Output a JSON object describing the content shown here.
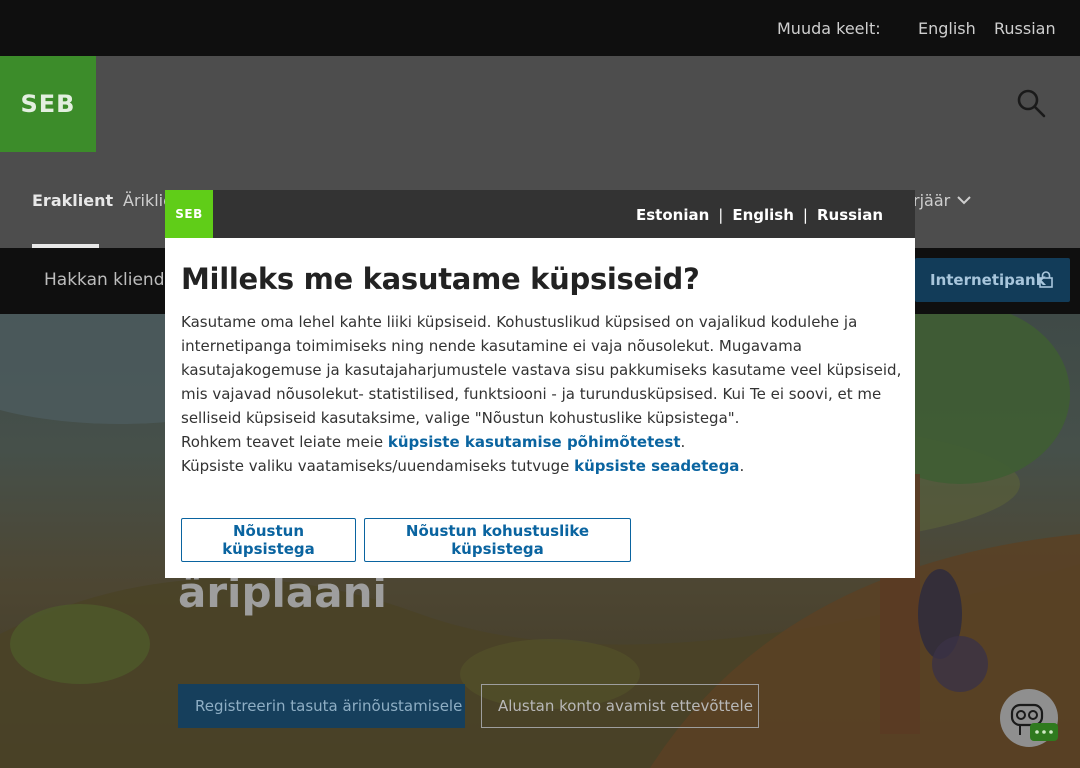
{
  "topbar": {
    "change_language_label": "Muuda keelt:",
    "lang_english": "English",
    "lang_russian": "Russian"
  },
  "header": {
    "logo_text": "SEB",
    "nav_items": {
      "private": "Eraklient",
      "business_partial": "Äriklient",
      "more_partial": "rjäär"
    }
  },
  "subbar": {
    "label_partial": "Hakkan kliendiks",
    "netbank_button": "Internetipank"
  },
  "hero": {
    "title_partial": "äriplaani",
    "register_button": "Registreerin tasuta ärinõustamisele",
    "open_account_button": "Alustan konto avamist ettevõttele"
  },
  "cookie_modal": {
    "logo_text": "SEB",
    "languages": {
      "estonian": "Estonian",
      "english": "English",
      "russian": "Russian",
      "separator": "|"
    },
    "title": "Milleks me kasutame küpsiseid?",
    "paragraph": "Kasutame oma lehel kahte liiki küpsiseid. Kohustuslikud küpsised on vajalikud kodulehe ja internetipanga toimimiseks ning nende kasutamine ei vaja nõusolekut. Mugavama kasutajakogemuse ja kasutajaharjumustele vastava sisu pakkumiseks kasutame veel küpsiseid, mis vajavad nõusolekut- statistilised, funktsiooni - ja turundusküpsised. Kui Te ei soovi, et me selliseid küpsiseid kasutaksime, valige \"Nõustun kohustuslike küpsistega\".",
    "more_info_prefix": "Rohkem teavet leiate meie ",
    "more_info_link": "küpsiste kasutamise põhimõtetest",
    "more_info_suffix": ".",
    "settings_prefix": "Küpsiste valiku vaatamiseks/uuendamiseks tutvuge ",
    "settings_link": "küpsiste seadetega",
    "settings_suffix": ".",
    "accept_all_button": "Nõustun küpsistega",
    "accept_required_button": "Nõustun kohustuslike küpsistega"
  },
  "colors": {
    "seb_green": "#60cd18",
    "link_blue": "#0a64a0",
    "modal_header": "#333333"
  }
}
